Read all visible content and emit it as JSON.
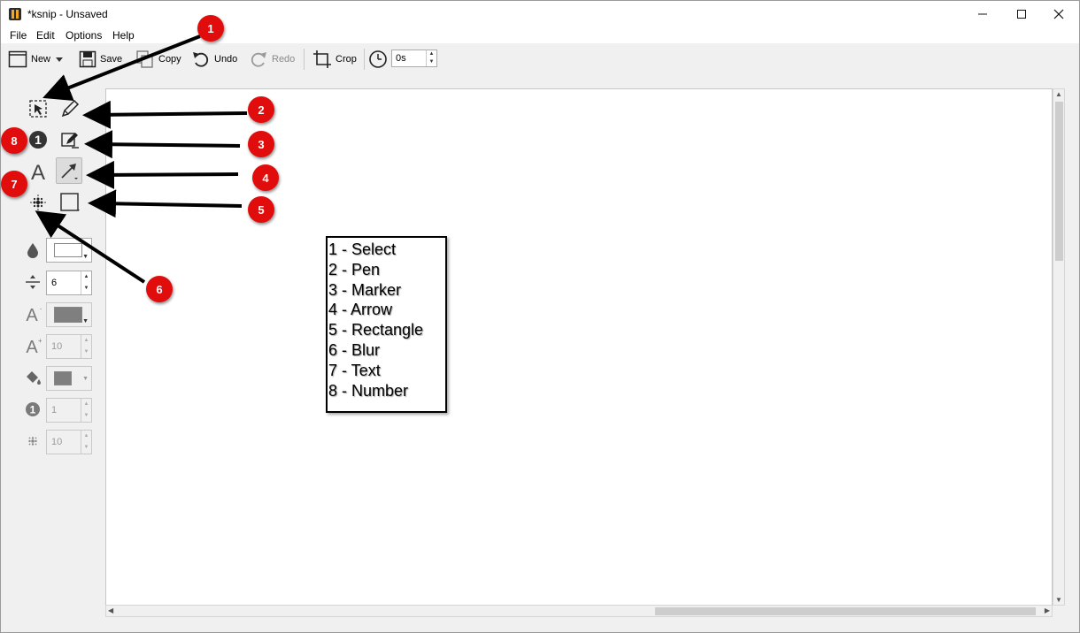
{
  "window": {
    "title": "*ksnip - Unsaved"
  },
  "menu": [
    {
      "label": "File"
    },
    {
      "label": "Edit"
    },
    {
      "label": "Options"
    },
    {
      "label": "Help"
    }
  ],
  "toolbar": {
    "new_label": "New",
    "save_label": "Save",
    "copy_label": "Copy",
    "undo_label": "Undo",
    "redo_label": "Redo",
    "crop_label": "Crop",
    "delay_value": "0s"
  },
  "tools": [
    {
      "name": "select",
      "icon": "select-icon"
    },
    {
      "name": "pen",
      "icon": "pen-icon"
    },
    {
      "name": "number",
      "icon": "number-icon"
    },
    {
      "name": "marker",
      "icon": "marker-icon"
    },
    {
      "name": "text",
      "icon": "text-icon"
    },
    {
      "name": "arrow",
      "icon": "arrow-icon",
      "active": true
    },
    {
      "name": "blur",
      "icon": "blur-icon"
    },
    {
      "name": "rectangle",
      "icon": "rectangle-icon"
    }
  ],
  "properties": {
    "stroke_width": "6",
    "font_size": "10",
    "number_value": "1",
    "blur_radius": "10",
    "color_primary": "#ffffff",
    "color_text": "#7f7f7f",
    "color_fill": "#7f7f7f"
  },
  "legend": [
    "1 - Select",
    "2 - Pen",
    "3 - Marker",
    "4 - Arrow",
    "5 - Rectangle",
    "6 - Blur",
    "7 - Text",
    "8 - Number"
  ],
  "badges": [
    "1",
    "2",
    "3",
    "4",
    "5",
    "6",
    "7",
    "8"
  ],
  "colors": {
    "badge": "#e10d0d",
    "window_bg": "#f0f0f0",
    "canvas": "#ffffff"
  }
}
